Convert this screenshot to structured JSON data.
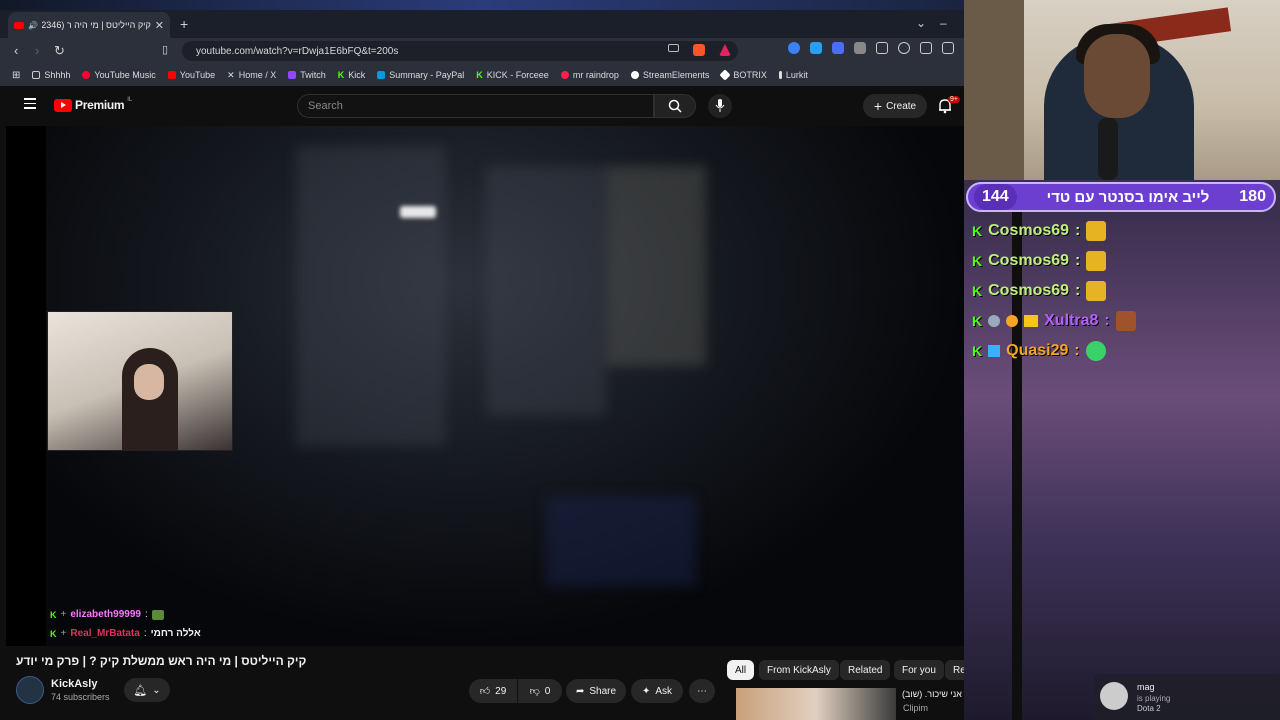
{
  "browser": {
    "tab_title": "קיק הייליטס | מי היה ר (2346)",
    "url": "youtube.com/watch?v=rDwja1E6bFQ&t=200s",
    "bookmarks": [
      {
        "label": "Shhhh",
        "color": "#cccccc"
      },
      {
        "label": "YouTube Music",
        "color": "#ff0033"
      },
      {
        "label": "YouTube",
        "color": "#ff0000"
      },
      {
        "label": "Home / X",
        "color": "#ffffff"
      },
      {
        "label": "Twitch",
        "color": "#9146ff"
      },
      {
        "label": "Kick",
        "color": "#53fc18"
      },
      {
        "label": "Summary - PayPal",
        "color": "#009cde"
      },
      {
        "label": "KICK - Forceee",
        "color": "#53fc18"
      },
      {
        "label": "mr raindrop",
        "color": "#ff2050"
      },
      {
        "label": "StreamElements",
        "color": "#ffffff"
      },
      {
        "label": "BOTRIX",
        "color": "#ffffff"
      },
      {
        "label": "Lurkit",
        "color": "#dddddd"
      }
    ]
  },
  "youtube": {
    "logo": "Premium",
    "logo_region": "IL",
    "search_placeholder": "Search",
    "create_label": "Create",
    "notif_count": "9+",
    "video_title": "קיק הייליטס | מי היה ראש ממשלת קיק ? | פרק מי יודע",
    "channel_name": "KickAsly",
    "subscribers": "74 subscribers",
    "likes": "29",
    "dislikes": "0",
    "share_label": "Share",
    "ask_label": "Ask",
    "chips": [
      "All",
      "From KickAsly",
      "Related",
      "For you",
      "Re"
    ],
    "rec_title": "אני שיכור. (שוב)",
    "rec_channel": "Clipim",
    "overlay_chat": [
      {
        "user": "elizabeth99999",
        "sep": ":",
        "msg": "",
        "color": "#ff77ff"
      },
      {
        "user": "Real_MrBatata",
        "sep": ":",
        "msg": "אללה רחמי",
        "color": "#e0335a"
      }
    ]
  },
  "stream": {
    "banner_left": "144",
    "banner_title": "לייב אימו בסנטר עם טדי",
    "banner_right": "180",
    "chat": [
      {
        "user": "Cosmos69",
        "sep": ":",
        "color": "#c0f07a"
      },
      {
        "user": "Cosmos69",
        "sep": ":",
        "color": "#c0f07a"
      },
      {
        "user": "Cosmos69",
        "sep": ":",
        "color": "#c0f07a"
      },
      {
        "user": "Xultra8",
        "sep": ":",
        "color": "#b560ff"
      },
      {
        "user": "Quasi29",
        "sep": ":",
        "color": "#f5a524"
      }
    ],
    "notification": {
      "name": "mag",
      "status": "is playing",
      "game": "Dota 2"
    }
  }
}
